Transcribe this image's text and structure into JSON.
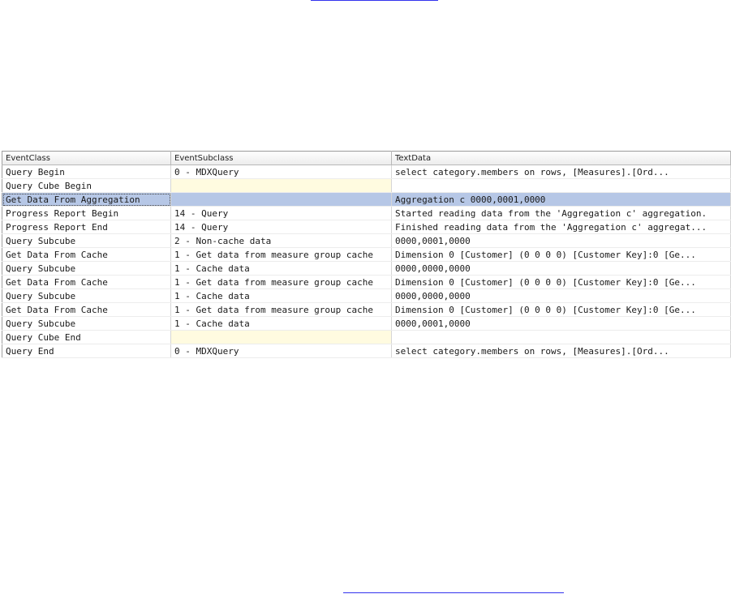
{
  "columns": [
    "EventClass",
    "EventSubclass",
    "TextData"
  ],
  "rows": [
    {
      "event_class": "Query Begin",
      "event_subclass": "0 - MDXQuery",
      "text_data": "select category.members on rows,          [Measures].[Ord..."
    },
    {
      "event_class": "Query Cube Begin",
      "event_subclass": "",
      "text_data": ""
    },
    {
      "event_class": "Get Data From Aggregation",
      "event_subclass": "",
      "text_data": "Aggregation c 0000,0001,0000"
    },
    {
      "event_class": "Progress Report Begin",
      "event_subclass": "14 - Query",
      "text_data": "Started reading data from the 'Aggregation c' aggregation."
    },
    {
      "event_class": "Progress Report End",
      "event_subclass": "14 - Query",
      "text_data": "Finished reading data from the 'Aggregation c' aggregat..."
    },
    {
      "event_class": "Query Subcube",
      "event_subclass": "2 - Non-cache data",
      "text_data": "0000,0001,0000"
    },
    {
      "event_class": "Get Data From Cache",
      "event_subclass": "1 - Get data from measure group cache",
      "text_data": "Dimension 0 [Customer] (0 0 0 0)  [Customer Key]:0  [Ge..."
    },
    {
      "event_class": "Query Subcube",
      "event_subclass": "1 - Cache data",
      "text_data": "0000,0000,0000"
    },
    {
      "event_class": "Get Data From Cache",
      "event_subclass": "1 - Get data from measure group cache",
      "text_data": "Dimension 0 [Customer] (0 0 0 0)  [Customer Key]:0  [Ge..."
    },
    {
      "event_class": "Query Subcube",
      "event_subclass": "1 - Cache data",
      "text_data": "0000,0000,0000"
    },
    {
      "event_class": "Get Data From Cache",
      "event_subclass": "1 - Get data from measure group cache",
      "text_data": "Dimension 0 [Customer] (0 0 0 0)  [Customer Key]:0  [Ge..."
    },
    {
      "event_class": "Query Subcube",
      "event_subclass": "1 - Cache data",
      "text_data": "0000,0001,0000"
    },
    {
      "event_class": "Query Cube End",
      "event_subclass": "",
      "text_data": ""
    },
    {
      "event_class": "Query End",
      "event_subclass": "0 - MDXQuery",
      "text_data": "select category.members on rows,          [Measures].[Ord..."
    }
  ],
  "selected_row_index": 2,
  "colors": {
    "selected_row": "#b6c7e6",
    "empty_subclass_cell": "#fffbe0",
    "link_underline": "#3333ee"
  }
}
